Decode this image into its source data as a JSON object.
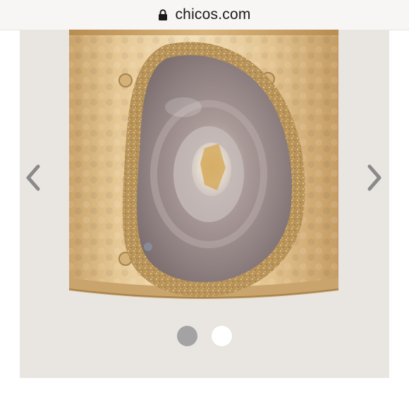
{
  "browser": {
    "url": "chicos.com",
    "lock_icon": "lock-icon"
  },
  "carousel": {
    "prev_icon": "chevron-left-icon",
    "next_icon": "chevron-right-icon",
    "total_slides": 2,
    "current_slide": 1,
    "colors": {
      "arrow": "#8a8a8a",
      "dot_active": "#a3a3a3",
      "dot_inactive": "#ffffff",
      "background": "#e9e5e1"
    }
  },
  "product": {
    "image_icon": "agate-cuff-bracelet-image"
  }
}
